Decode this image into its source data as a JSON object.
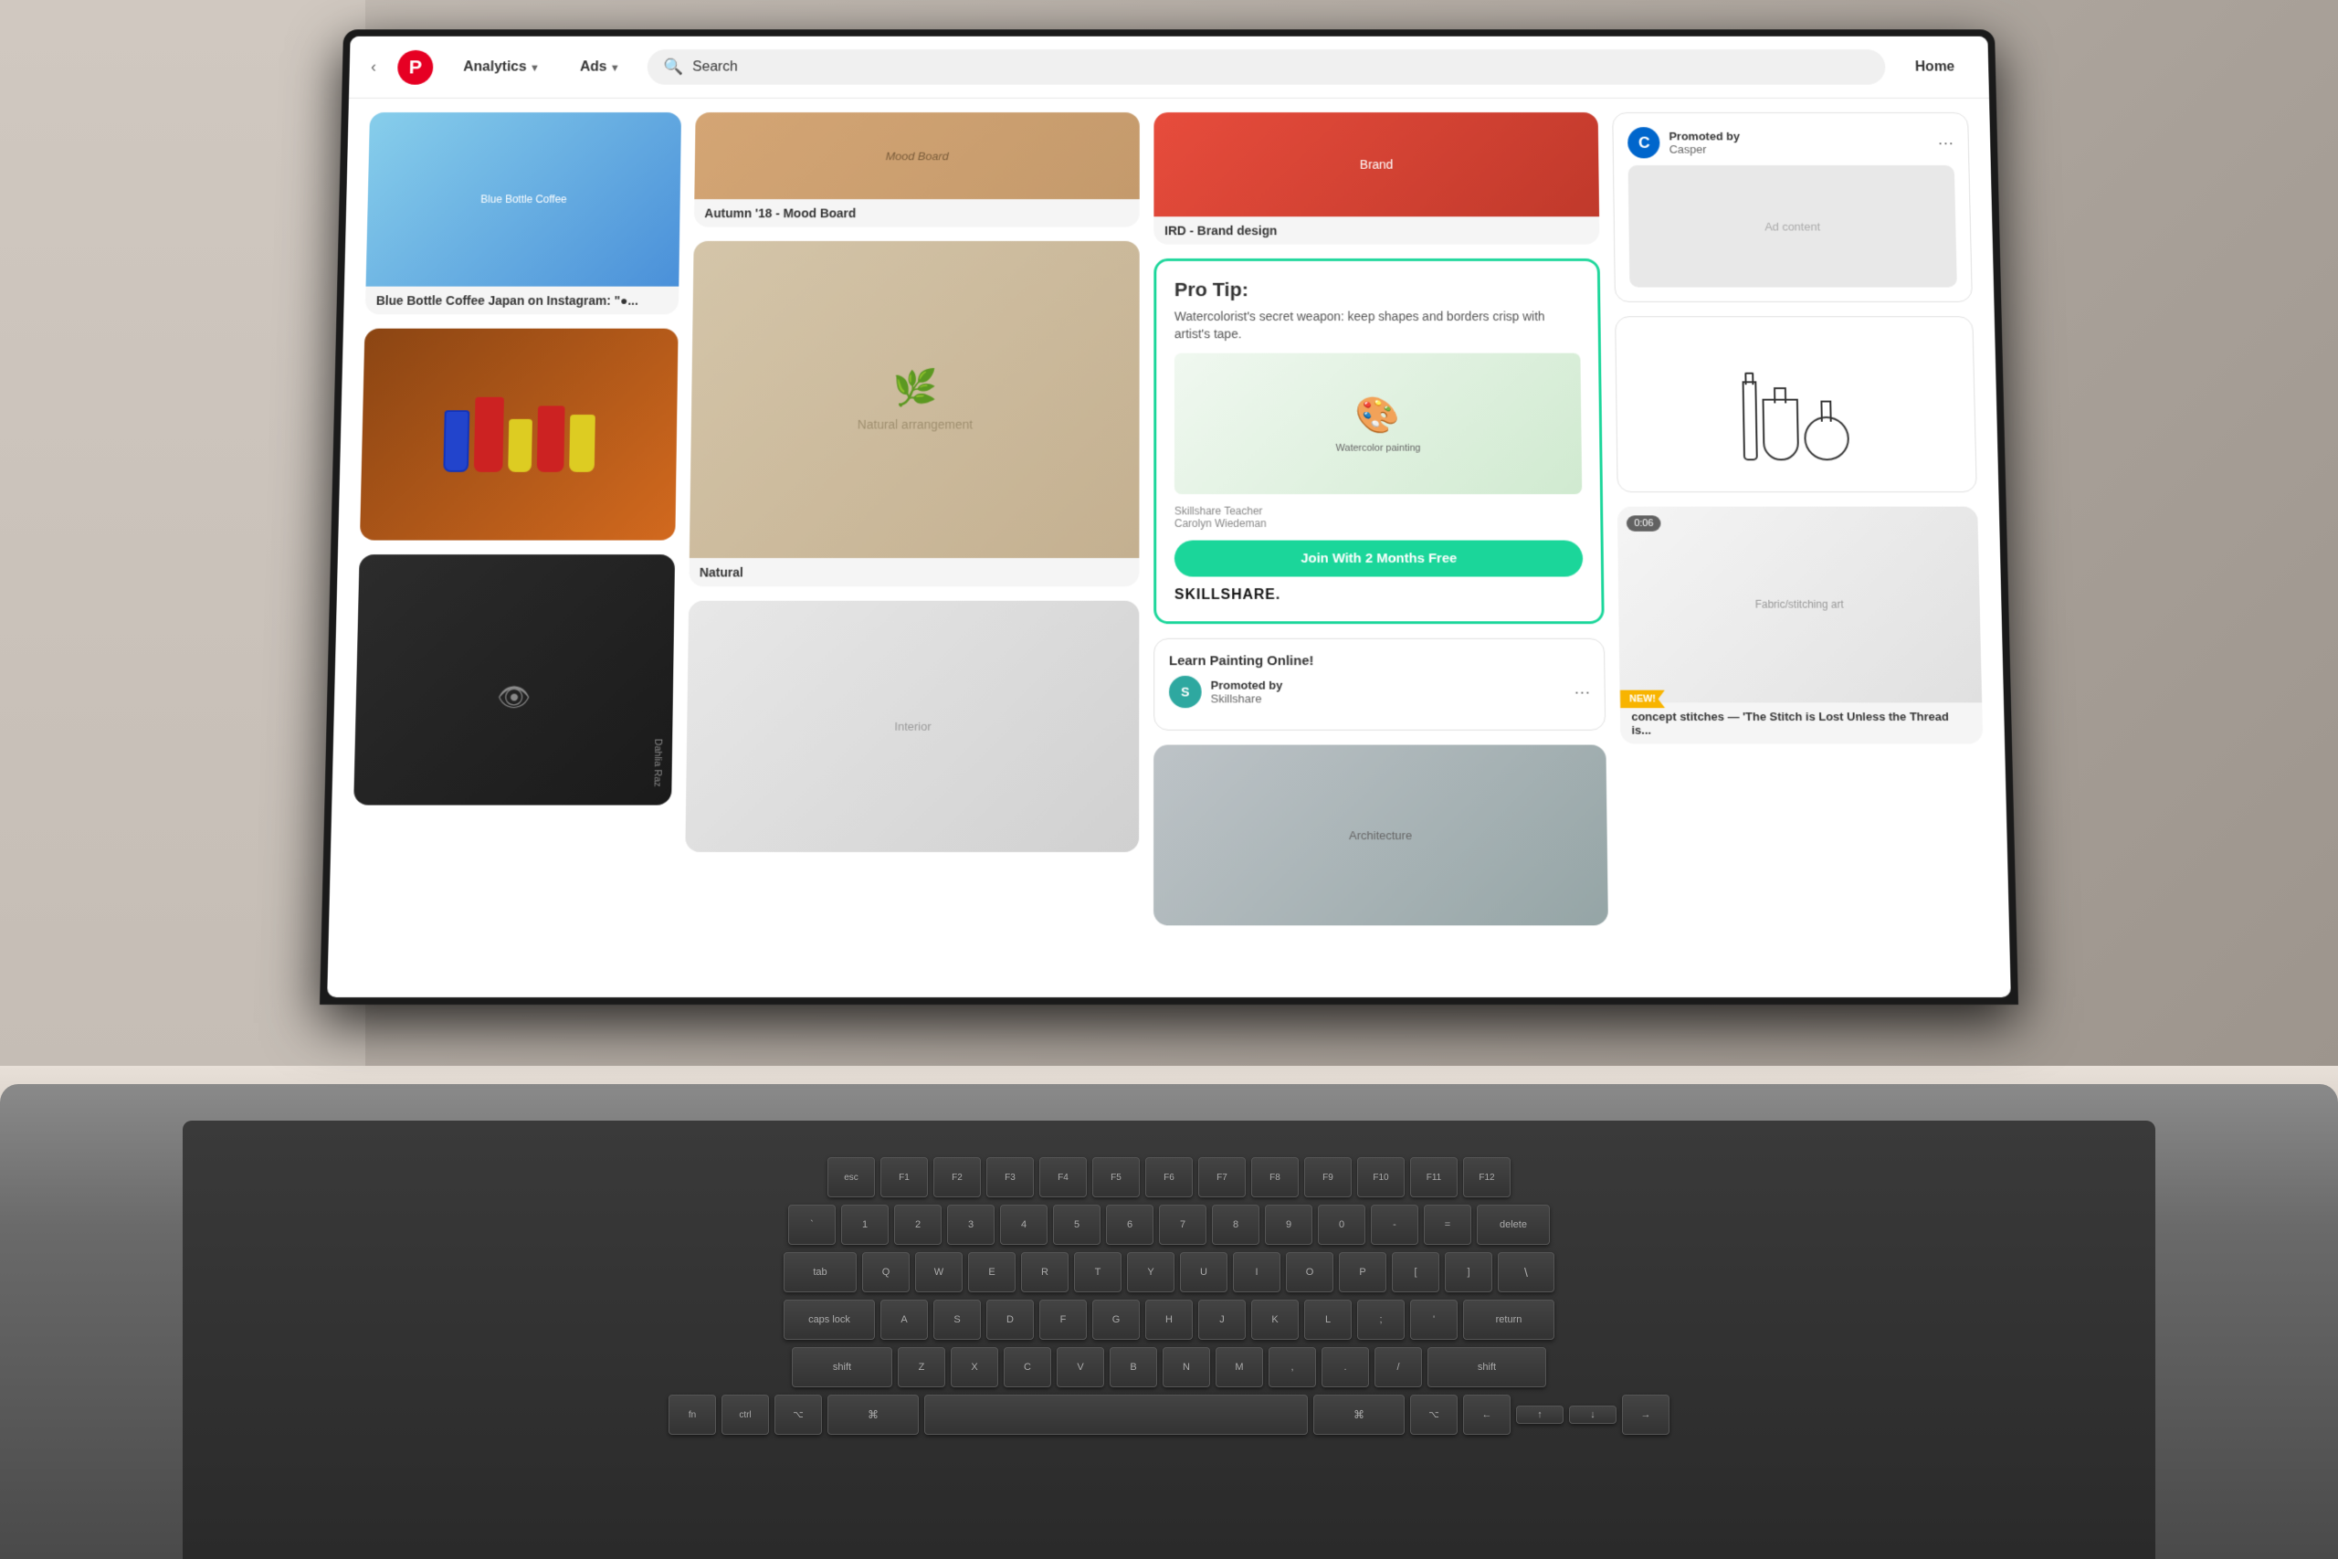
{
  "app": {
    "name": "Pinterest",
    "logo_char": "P"
  },
  "nav": {
    "analytics_label": "Analytics",
    "ads_label": "Ads",
    "search_placeholder": "Search",
    "home_label": "Home"
  },
  "pins": {
    "blue_bottle": {
      "title": "Blue Bottle Coffee Japan on Instagram: \"●..."
    },
    "autumn": {
      "title": "Autumn '18 - Mood Board"
    },
    "natural": {
      "title": "Natural"
    },
    "ird": {
      "title": "IRD - Brand design"
    },
    "vases": {
      "title": ""
    },
    "pants": {
      "author": "Dahlia Raz"
    },
    "concept_stitches": {
      "title": "concept stitches — 'The Stitch is Lost Unless the Thread is..."
    },
    "learn_painting": {
      "title": "Learn Painting Online!"
    },
    "architecture": {
      "title": ""
    }
  },
  "skillshare": {
    "pro_tip_title": "Pro Tip:",
    "pro_tip_body": "Watercolorist's secret weapon: keep shapes and borders crisp with artist's tape.",
    "teacher_label": "Skillshare Teacher",
    "teacher_name": "Carolyn Wiedeman",
    "join_button": "Join With 2 Months Free",
    "logo": "SKILLSHARE."
  },
  "promoted_casper": {
    "promoted_by": "Promoted by",
    "brand": "Casper",
    "more_icon": "···"
  },
  "promoted_skillshare": {
    "learn_painting": "Learn Painting Online!",
    "promoted_by": "Promoted by",
    "brand": "Skillshare",
    "more_icon": "···"
  },
  "video": {
    "duration": "0:06",
    "new_badge": "NEW!"
  }
}
